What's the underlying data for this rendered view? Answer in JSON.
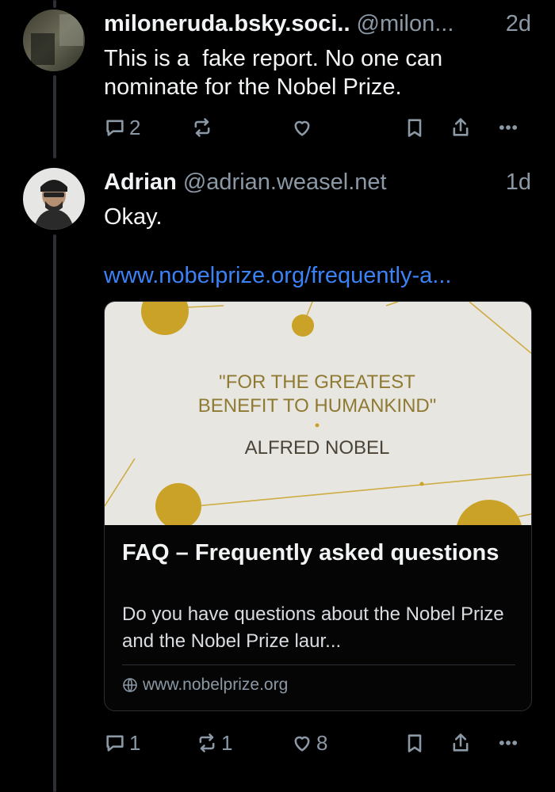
{
  "thread": {
    "posts": [
      {
        "name": "miloneruda.bsky.soci..",
        "handle": "@milon...",
        "time": "2d",
        "text": "This is a  fake report. No one can nominate for the Nobel Prize.",
        "actions": {
          "replies": "2",
          "reposts": "",
          "likes": ""
        }
      },
      {
        "name": "Adrian",
        "handle": "@adrian.weasel.net",
        "time": "1d",
        "text": "Okay.",
        "link": "www.nobelprize.org/frequently-a...",
        "card": {
          "image": {
            "quote_line1": "\"FOR THE GREATEST",
            "quote_line2": "BENEFIT TO HUMANKIND\"",
            "author": "ALFRED NOBEL",
            "background_color": "#e8e6e1",
            "gold_color": "#c9a227"
          },
          "title": "FAQ – Frequently asked questions",
          "description": "Do you have questions about the Nobel Prize and the Nobel Prize laur...",
          "domain": "www.nobelprize.org"
        },
        "actions": {
          "replies": "1",
          "reposts": "1",
          "likes": "8"
        }
      }
    ]
  },
  "icons": {
    "reply": "speech-bubble-icon",
    "repost": "repost-arrows-icon",
    "like": "heart-icon",
    "bookmark": "bookmark-icon",
    "share": "share-icon",
    "more": "ellipsis-icon",
    "globe": "globe-icon"
  },
  "colors": {
    "background": "#000000",
    "text": "#f1f3f5",
    "muted": "#8b98a5",
    "link": "#3b82f6",
    "thread_line": "#2c2f33"
  }
}
